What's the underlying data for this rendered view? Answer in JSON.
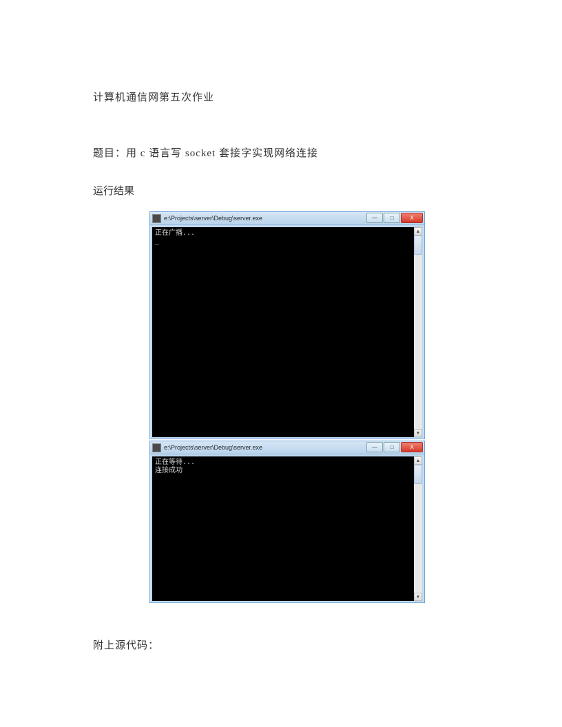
{
  "doc": {
    "title": "计算机通信网第五次作业",
    "topic": "题目：用 c 语言写 socket 套接字实现网络连接",
    "result_label": "运行结果",
    "source_label": "附上源代码："
  },
  "window1": {
    "title": "e:\\Projects\\server\\Debug\\server.exe",
    "console_lines": "正在广播...\n_",
    "buttons": {
      "min": "—",
      "max": "□",
      "close": "X"
    },
    "scroll": {
      "up": "▲",
      "down": "▼"
    }
  },
  "window2": {
    "title": "e:\\Projects\\server\\Debug\\server.exe",
    "console_lines": "正在等待...\n连接成功",
    "buttons": {
      "min": "—",
      "max": "□",
      "close": "X"
    },
    "scroll": {
      "up": "▲",
      "down": "▼"
    }
  }
}
